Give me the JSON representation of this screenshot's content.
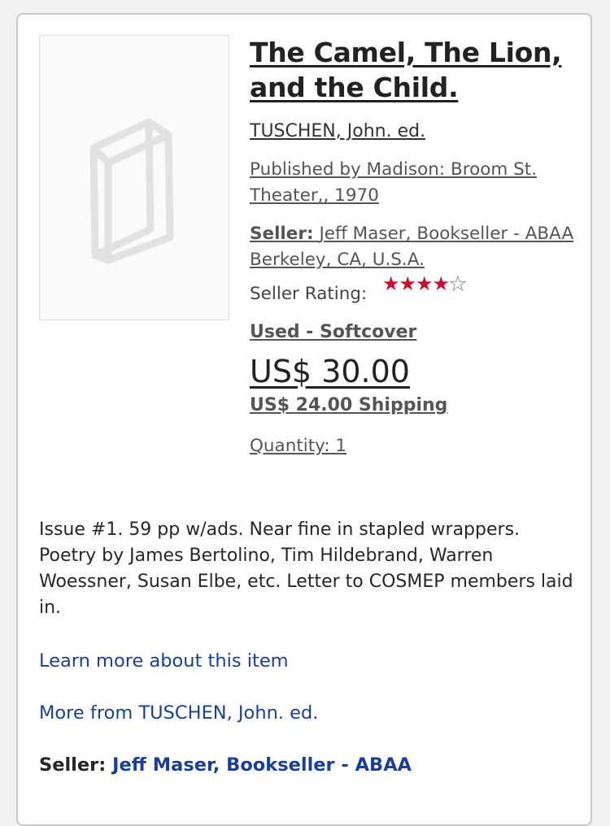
{
  "book": {
    "title": "The Camel, The Lion, and the Child.",
    "author": "TUSCHEN, John. ed.",
    "publisher": "Published by Madison: Broom St. Theater,, 1970"
  },
  "seller": {
    "label": "Seller:",
    "name": "Jeff Maser, Bookseller - ABAA",
    "location": "Berkeley, CA, U.S.A.",
    "rating_label": "Seller Rating:",
    "rating_value": 4,
    "rating_max": 5
  },
  "offer": {
    "condition": "Used - Softcover",
    "price": "US$ 30.00",
    "shipping": "US$ 24.00 Shipping",
    "quantity": "Quantity: 1"
  },
  "description": "Issue #1. 59 pp w/ads. Near fine in stapled wrappers. Poetry by James Bertolino, Tim Hildebrand, Warren Woessner, Susan Elbe, etc. Letter to COSMEP members laid in.",
  "links": {
    "learn_more": "Learn more about this item",
    "more_from": "More from TUSCHEN, John. ed."
  },
  "colors": {
    "link": "#1a3f95",
    "star": "#c8102e"
  },
  "icons": {
    "thumbnail": "book-placeholder-icon",
    "rating": "star-icon"
  }
}
